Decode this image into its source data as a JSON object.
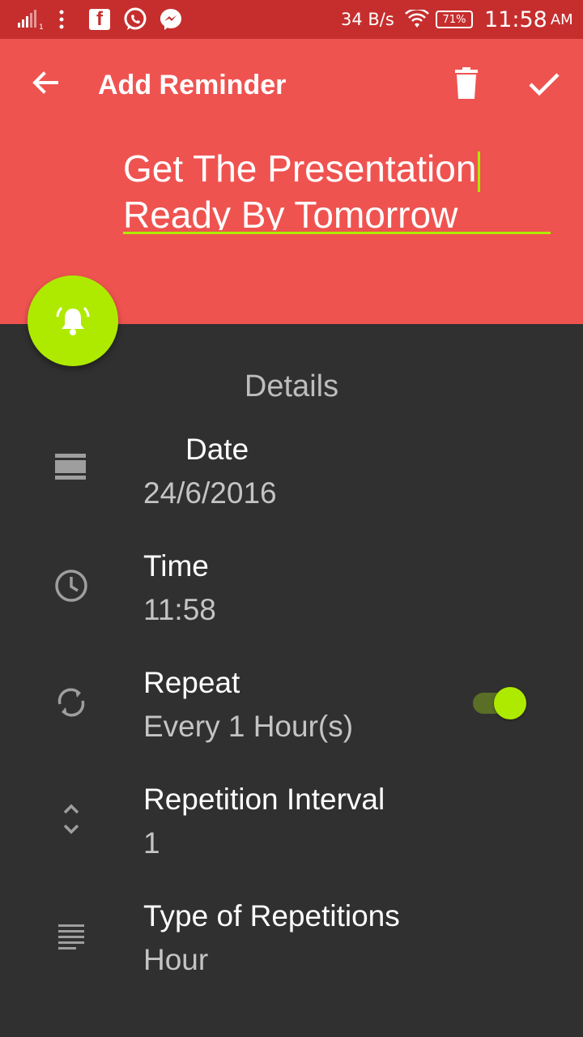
{
  "status_bar": {
    "network_speed": "34 B/s",
    "battery": "71%",
    "time": "11:58",
    "ampm": "AM"
  },
  "toolbar": {
    "title": "Add Reminder"
  },
  "reminder": {
    "text": "Get The Presentation Ready By Tomorrow"
  },
  "details": {
    "title": "Details",
    "date_label": "Date",
    "date_value": "24/6/2016",
    "time_label": "Time",
    "time_value": "11:58",
    "repeat_label": "Repeat",
    "repeat_value": "Every 1 Hour(s)",
    "repeat_enabled": true,
    "interval_label": "Repetition Interval",
    "interval_value": "1",
    "type_label": "Type of Repetitions",
    "type_value": "Hour"
  },
  "colors": {
    "header": "#ef5350",
    "status_bar": "#c62e2e",
    "accent": "#aeea00",
    "background": "#303030"
  }
}
